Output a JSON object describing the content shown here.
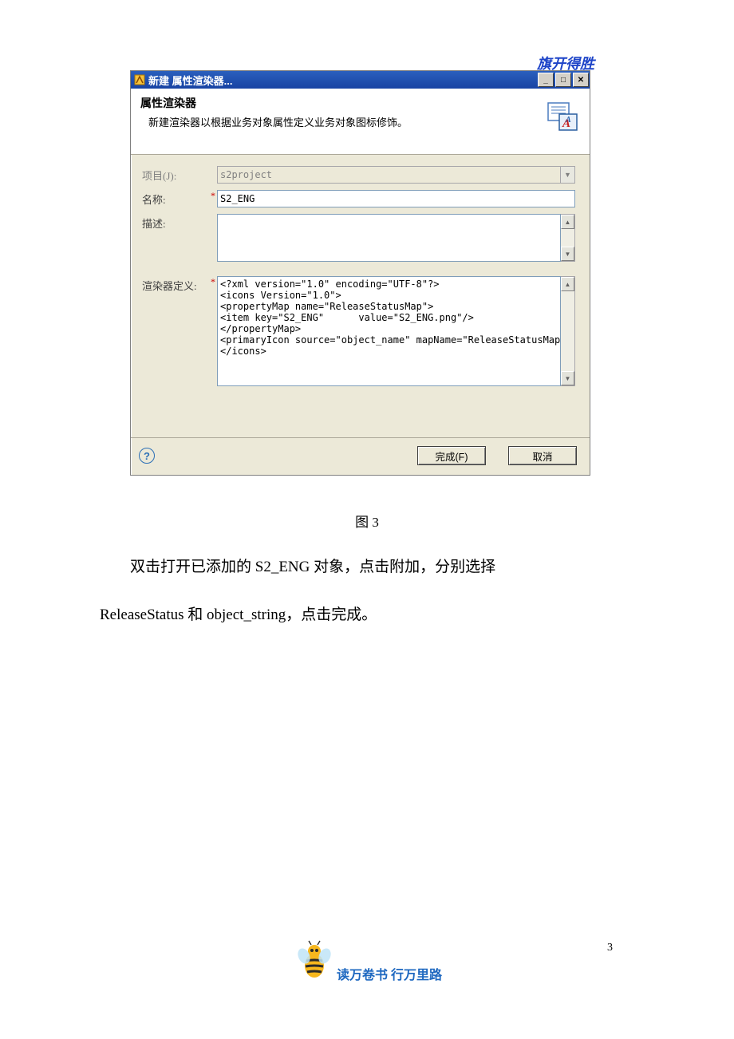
{
  "header_slogan": "旗开得胜",
  "dialog": {
    "title": "新建 属性渲染器...",
    "banner_title": "属性渲染器",
    "banner_desc": "新建渲染器以根据业务对象属性定义业务对象图标修饰。",
    "labels": {
      "project": "项目(J):",
      "name": "名称:",
      "desc": "描述:",
      "def": "渲染器定义:"
    },
    "project_value": "s2project",
    "name_value": "S2_ENG",
    "desc_value": "",
    "def_value": "<?xml version=\"1.0\" encoding=\"UTF-8\"?>\n<icons Version=\"1.0\">\n<propertyMap name=\"ReleaseStatusMap\">\n<item key=\"S2_ENG\"      value=\"S2_ENG.png\"/>\n</propertyMap>\n<primaryIcon source=\"object_name\" mapName=\"ReleaseStatusMap\"/>\n</icons>",
    "finish_btn": "完成(F)",
    "cancel_btn": "取消"
  },
  "figure_caption": "图 3",
  "body_p1": "双击打开已添加的 S2_ENG 对象，点击附加，分别选择",
  "body_p2": "ReleaseStatus 和 object_string，点击完成。",
  "footer_text": "读万卷书 行万里路",
  "page_number": "3"
}
